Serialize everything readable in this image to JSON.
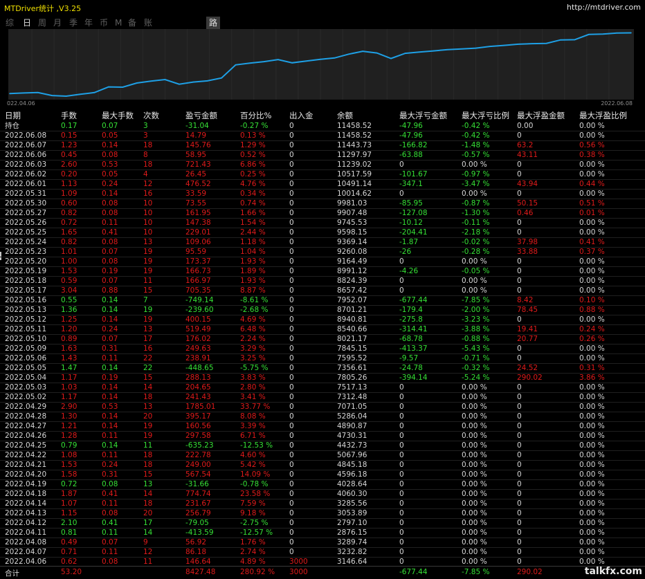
{
  "window": {
    "title": "MTDriver统计 ,V3.25",
    "url": "http://mtdriver.com"
  },
  "tabs": [
    "综",
    "日",
    "周",
    "月",
    "季",
    "年",
    "币",
    "M",
    "备",
    "账户",
    "路径"
  ],
  "active_tab": "日",
  "chart_data": {
    "type": "line",
    "x_start_label": "022.04.06",
    "x_end_label": "2022.06.08",
    "x": [
      "2022.04.06",
      "2022.04.07",
      "2022.04.08",
      "2022.04.11",
      "2022.04.12",
      "2022.04.13",
      "2022.04.14",
      "2022.04.18",
      "2022.04.19",
      "2022.04.20",
      "2022.04.21",
      "2022.04.22",
      "2022.04.25",
      "2022.04.26",
      "2022.04.27",
      "2022.04.28",
      "2022.04.29",
      "2022.05.02",
      "2022.05.03",
      "2022.05.04",
      "2022.05.05",
      "2022.05.06",
      "2022.05.09",
      "2022.05.10",
      "2022.05.11",
      "2022.05.12",
      "2022.05.13",
      "2022.05.16",
      "2022.05.17",
      "2022.05.18",
      "2022.05.19",
      "2022.05.20",
      "2022.05.23",
      "2022.05.24",
      "2022.05.25",
      "2022.05.26",
      "2022.05.27",
      "2022.05.30",
      "2022.05.31",
      "2022.06.01",
      "2022.06.02",
      "2022.06.03",
      "2022.06.06",
      "2022.06.07",
      "2022.06.08"
    ],
    "values": [
      3146.64,
      3232.82,
      3289.74,
      2876.15,
      2797.1,
      3053.89,
      3285.56,
      4060.3,
      4028.64,
      4596.18,
      4845.18,
      5067.96,
      4432.73,
      4730.31,
      4890.87,
      5286.04,
      7071.05,
      7312.48,
      7517.13,
      7805.26,
      7356.61,
      7595.52,
      7845.15,
      8021.17,
      8540.66,
      8940.81,
      8701.21,
      7952.07,
      8657.42,
      8824.39,
      8991.12,
      9164.49,
      9260.08,
      9369.14,
      9598.15,
      9745.53,
      9907.48,
      9981.03,
      10014.62,
      10491.14,
      10517.59,
      11239.02,
      11297.97,
      11443.73,
      11458.52
    ],
    "ylim": [
      2700,
      11600
    ],
    "line_color": "#1ea0e6",
    "grid": true
  },
  "table": {
    "headers": [
      "日期",
      "手数",
      "最大手数",
      "次数",
      "盈亏金额",
      "百分比%",
      "出入金",
      "余额",
      "最大浮亏金额",
      "最大浮亏比例",
      "最大浮盈金额",
      "最大浮盈比例"
    ],
    "rows": [
      [
        "持仓",
        "0.17",
        "0.07",
        "3",
        "-31.04",
        "-0.27 %",
        "0",
        "11458.52",
        "-47.96",
        "-0.42 %",
        "0.00",
        "0.00 %"
      ],
      [
        "2022.06.08",
        "0.15",
        "0.05",
        "3",
        "14.79",
        "0.13 %",
        "0",
        "11458.52",
        "-47.96",
        "-0.42 %",
        "0",
        "0.00 %"
      ],
      [
        "2022.06.07",
        "1.23",
        "0.14",
        "18",
        "145.76",
        "1.29 %",
        "0",
        "11443.73",
        "-166.82",
        "-1.48 %",
        "63.2",
        "0.56 %"
      ],
      [
        "2022.06.06",
        "0.45",
        "0.08",
        "8",
        "58.95",
        "0.52 %",
        "0",
        "11297.97",
        "-63.88",
        "-0.57 %",
        "43.11",
        "0.38 %"
      ],
      [
        "2022.06.03",
        "2.60",
        "0.53",
        "18",
        "721.43",
        "6.86 %",
        "0",
        "11239.02",
        "0",
        "0.00 %",
        "0",
        "0.00 %"
      ],
      [
        "2022.06.02",
        "0.20",
        "0.05",
        "4",
        "26.45",
        "0.25 %",
        "0",
        "10517.59",
        "-101.67",
        "-0.97 %",
        "0",
        "0.00 %"
      ],
      [
        "2022.06.01",
        "1.13",
        "0.24",
        "12",
        "476.52",
        "4.76 %",
        "0",
        "10491.14",
        "-347.1",
        "-3.47 %",
        "43.94",
        "0.44 %"
      ],
      [
        "2022.05.31",
        "1.09",
        "0.14",
        "16",
        "33.59",
        "0.34 %",
        "0",
        "10014.62",
        "0",
        "0.00 %",
        "0",
        "0.00 %"
      ],
      [
        "2022.05.30",
        "0.60",
        "0.08",
        "10",
        "73.55",
        "0.74 %",
        "0",
        "9981.03",
        "-85.95",
        "-0.87 %",
        "50.15",
        "0.51 %"
      ],
      [
        "2022.05.27",
        "0.82",
        "0.08",
        "10",
        "161.95",
        "1.66 %",
        "0",
        "9907.48",
        "-127.08",
        "-1.30 %",
        "0.46",
        "0.01 %"
      ],
      [
        "2022.05.26",
        "0.72",
        "0.11",
        "10",
        "147.38",
        "1.54 %",
        "0",
        "9745.53",
        "-10.12",
        "-0.11 %",
        "0",
        "0.00 %"
      ],
      [
        "2022.05.25",
        "1.65",
        "0.41",
        "10",
        "229.01",
        "2.44 %",
        "0",
        "9598.15",
        "-204.41",
        "-2.18 %",
        "0",
        "0.00 %"
      ],
      [
        "2022.05.24",
        "0.82",
        "0.08",
        "13",
        "109.06",
        "1.18 %",
        "0",
        "9369.14",
        "-1.87",
        "-0.02 %",
        "37.98",
        "0.41 %"
      ],
      [
        "2022.05.23",
        "1.01",
        "0.07",
        "19",
        "95.59",
        "1.04 %",
        "0",
        "9260.08",
        "-26",
        "-0.28 %",
        "33.88",
        "0.37 %"
      ],
      [
        "2022.05.20",
        "1.00",
        "0.08",
        "19",
        "173.37",
        "1.93 %",
        "0",
        "9164.49",
        "0",
        "0.00 %",
        "0",
        "0.00 %"
      ],
      [
        "2022.05.19",
        "1.53",
        "0.19",
        "19",
        "166.73",
        "1.89 %",
        "0",
        "8991.12",
        "-4.26",
        "-0.05 %",
        "0",
        "0.00 %"
      ],
      [
        "2022.05.18",
        "0.59",
        "0.07",
        "11",
        "166.97",
        "1.93 %",
        "0",
        "8824.39",
        "0",
        "0.00 %",
        "0",
        "0.00 %"
      ],
      [
        "2022.05.17",
        "3.04",
        "0.88",
        "15",
        "705.35",
        "8.87 %",
        "0",
        "8657.42",
        "0",
        "0.00 %",
        "0",
        "0.00 %"
      ],
      [
        "2022.05.16",
        "0.55",
        "0.14",
        "7",
        "-749.14",
        "-8.61 %",
        "0",
        "7952.07",
        "-677.44",
        "-7.85 %",
        "8.42",
        "0.10 %"
      ],
      [
        "2022.05.13",
        "1.36",
        "0.14",
        "19",
        "-239.60",
        "-2.68 %",
        "0",
        "8701.21",
        "-179.4",
        "-2.00 %",
        "78.45",
        "0.88 %"
      ],
      [
        "2022.05.12",
        "1.25",
        "0.14",
        "19",
        "400.15",
        "4.69 %",
        "0",
        "8940.81",
        "-275.8",
        "-3.23 %",
        "0",
        "0.00 %"
      ],
      [
        "2022.05.11",
        "1.20",
        "0.24",
        "13",
        "519.49",
        "6.48 %",
        "0",
        "8540.66",
        "-314.41",
        "-3.88 %",
        "19.41",
        "0.24 %"
      ],
      [
        "2022.05.10",
        "0.89",
        "0.07",
        "17",
        "176.02",
        "2.24 %",
        "0",
        "8021.17",
        "-68.78",
        "-0.88 %",
        "20.77",
        "0.26 %"
      ],
      [
        "2022.05.09",
        "1.63",
        "0.31",
        "16",
        "249.63",
        "3.29 %",
        "0",
        "7845.15",
        "-413.37",
        "-5.43 %",
        "0",
        "0.00 %"
      ],
      [
        "2022.05.06",
        "1.43",
        "0.11",
        "22",
        "238.91",
        "3.25 %",
        "0",
        "7595.52",
        "-9.57",
        "-0.71 %",
        "0",
        "0.00 %"
      ],
      [
        "2022.05.05",
        "1.47",
        "0.14",
        "22",
        "-448.65",
        "-5.75 %",
        "0",
        "7356.61",
        "-24.78",
        "-0.32 %",
        "24.52",
        "0.31 %"
      ],
      [
        "2022.05.04",
        "1.17",
        "0.19",
        "15",
        "288.13",
        "3.83 %",
        "0",
        "7805.26",
        "-394.14",
        "-5.24 %",
        "290.02",
        "3.86 %"
      ],
      [
        "2022.05.03",
        "1.03",
        "0.14",
        "14",
        "204.65",
        "2.80 %",
        "0",
        "7517.13",
        "0",
        "0.00 %",
        "0",
        "0.00 %"
      ],
      [
        "2022.05.02",
        "1.17",
        "0.14",
        "18",
        "241.43",
        "3.41 %",
        "0",
        "7312.48",
        "0",
        "0.00 %",
        "0",
        "0.00 %"
      ],
      [
        "2022.04.29",
        "2.90",
        "0.53",
        "13",
        "1785.01",
        "33.77 %",
        "0",
        "7071.05",
        "0",
        "0.00 %",
        "0",
        "0.00 %"
      ],
      [
        "2022.04.28",
        "1.30",
        "0.14",
        "20",
        "395.17",
        "8.08 %",
        "0",
        "5286.04",
        "0",
        "0.00 %",
        "0",
        "0.00 %"
      ],
      [
        "2022.04.27",
        "1.21",
        "0.14",
        "19",
        "160.56",
        "3.39 %",
        "0",
        "4890.87",
        "0",
        "0.00 %",
        "0",
        "0.00 %"
      ],
      [
        "2022.04.26",
        "1.28",
        "0.11",
        "19",
        "297.58",
        "6.71 %",
        "0",
        "4730.31",
        "0",
        "0.00 %",
        "0",
        "0.00 %"
      ],
      [
        "2022.04.25",
        "0.79",
        "0.14",
        "11",
        "-635.23",
        "-12.53 %",
        "0",
        "4432.73",
        "0",
        "0.00 %",
        "0",
        "0.00 %"
      ],
      [
        "2022.04.22",
        "1.08",
        "0.11",
        "18",
        "222.78",
        "4.60 %",
        "0",
        "5067.96",
        "0",
        "0.00 %",
        "0",
        "0.00 %"
      ],
      [
        "2022.04.21",
        "1.53",
        "0.24",
        "18",
        "249.00",
        "5.42 %",
        "0",
        "4845.18",
        "0",
        "0.00 %",
        "0",
        "0.00 %"
      ],
      [
        "2022.04.20",
        "1.58",
        "0.31",
        "15",
        "567.54",
        "14.09 %",
        "0",
        "4596.18",
        "0",
        "0.00 %",
        "0",
        "0.00 %"
      ],
      [
        "2022.04.19",
        "0.72",
        "0.08",
        "13",
        "-31.66",
        "-0.78 %",
        "0",
        "4028.64",
        "0",
        "0.00 %",
        "0",
        "0.00 %"
      ],
      [
        "2022.04.18",
        "1.87",
        "0.41",
        "14",
        "774.74",
        "23.58 %",
        "0",
        "4060.30",
        "0",
        "0.00 %",
        "0",
        "0.00 %"
      ],
      [
        "2022.04.14",
        "1.07",
        "0.11",
        "18",
        "231.67",
        "7.59 %",
        "0",
        "3285.56",
        "0",
        "0.00 %",
        "0",
        "0.00 %"
      ],
      [
        "2022.04.13",
        "1.15",
        "0.08",
        "20",
        "256.79",
        "9.18 %",
        "0",
        "3053.89",
        "0",
        "0.00 %",
        "0",
        "0.00 %"
      ],
      [
        "2022.04.12",
        "2.10",
        "0.41",
        "17",
        "-79.05",
        "-2.75 %",
        "0",
        "2797.10",
        "0",
        "0.00 %",
        "0",
        "0.00 %"
      ],
      [
        "2022.04.11",
        "0.81",
        "0.11",
        "14",
        "-413.59",
        "-12.57 %",
        "0",
        "2876.15",
        "0",
        "0.00 %",
        "0",
        "0.00 %"
      ],
      [
        "2022.04.08",
        "0.49",
        "0.07",
        "9",
        "56.92",
        "1.76 %",
        "0",
        "3289.74",
        "0",
        "0.00 %",
        "0",
        "0.00 %"
      ],
      [
        "2022.04.07",
        "0.71",
        "0.11",
        "12",
        "86.18",
        "2.74 %",
        "0",
        "3232.82",
        "0",
        "0.00 %",
        "0",
        "0.00 %"
      ],
      [
        "2022.04.06",
        "0.62",
        "0.08",
        "11",
        "146.64",
        "4.89 %",
        "3000",
        "3146.64",
        "0",
        "0.00 %",
        "0",
        "0.00 %"
      ]
    ],
    "total": [
      "合计",
      "53.20",
      "",
      "",
      "8427.48",
      "280.92 %",
      "3000",
      "",
      "-677.44",
      "-7.85 %",
      "290.02",
      ""
    ]
  },
  "watermark": "talkfx.com",
  "colors": {
    "profit": "#e01b1b",
    "loss": "#36e136",
    "neutral": "#d8d8d8",
    "title": "#f0e000"
  }
}
